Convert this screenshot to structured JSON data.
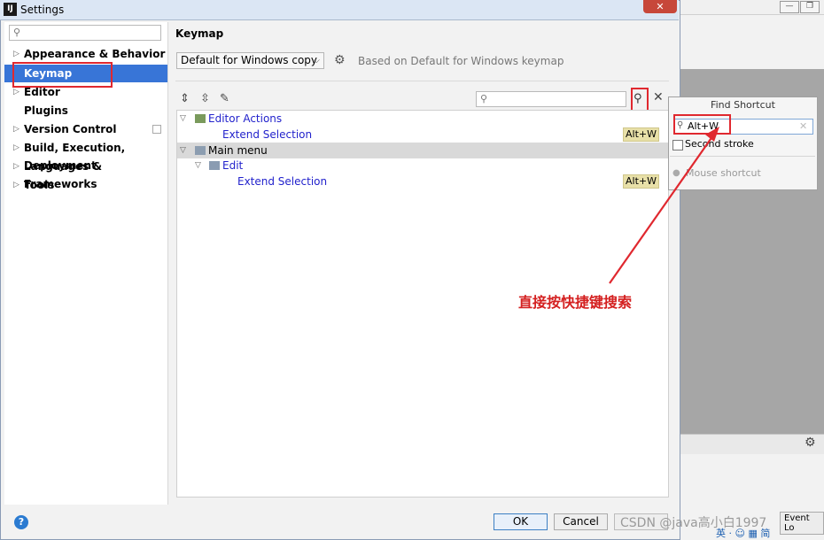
{
  "window": {
    "title": "Settings",
    "app_icon": "IJ",
    "close": "✕"
  },
  "sidebar": {
    "search_placeholder": "",
    "items": [
      {
        "label": "Appearance & Behavior",
        "expandable": true
      },
      {
        "label": "Keymap",
        "expandable": false,
        "selected": true
      },
      {
        "label": "Editor",
        "expandable": true
      },
      {
        "label": "Plugins",
        "expandable": false
      },
      {
        "label": "Version Control",
        "expandable": true
      },
      {
        "label": "Build, Execution, Deployment",
        "expandable": true
      },
      {
        "label": "Languages & Frameworks",
        "expandable": true
      },
      {
        "label": "Tools",
        "expandable": true
      }
    ]
  },
  "keymap": {
    "title": "Keymap",
    "selected_keymap": "Default for Windows copy",
    "based_on": "Based on Default for Windows keymap",
    "tree": [
      {
        "label": "Editor Actions",
        "shortcut": ""
      },
      {
        "label": "Extend Selection",
        "shortcut": "Alt+W"
      },
      {
        "label": "Main menu",
        "shortcut": ""
      },
      {
        "label": "Edit",
        "shortcut": ""
      },
      {
        "label": "Extend Selection",
        "shortcut": "Alt+W"
      }
    ]
  },
  "find_shortcut": {
    "title": "Find Shortcut",
    "input_value": "Alt+W",
    "second_stroke": "Second stroke",
    "mouse_shortcut": "Mouse shortcut"
  },
  "buttons": {
    "ok": "OK",
    "cancel": "Cancel",
    "help": "?"
  },
  "annotation": {
    "text": "直接按快捷键搜索",
    "color": "#e0282f"
  },
  "background": {
    "event_log": "Event Lo",
    "watermark": "CSDN @java高小白1997",
    "tray": "英 · ☺ ▦ 简"
  },
  "colors": {
    "selection": "#3875d7",
    "shortcut_badge": "#e8e0a8",
    "link_text": "#2222cc"
  }
}
